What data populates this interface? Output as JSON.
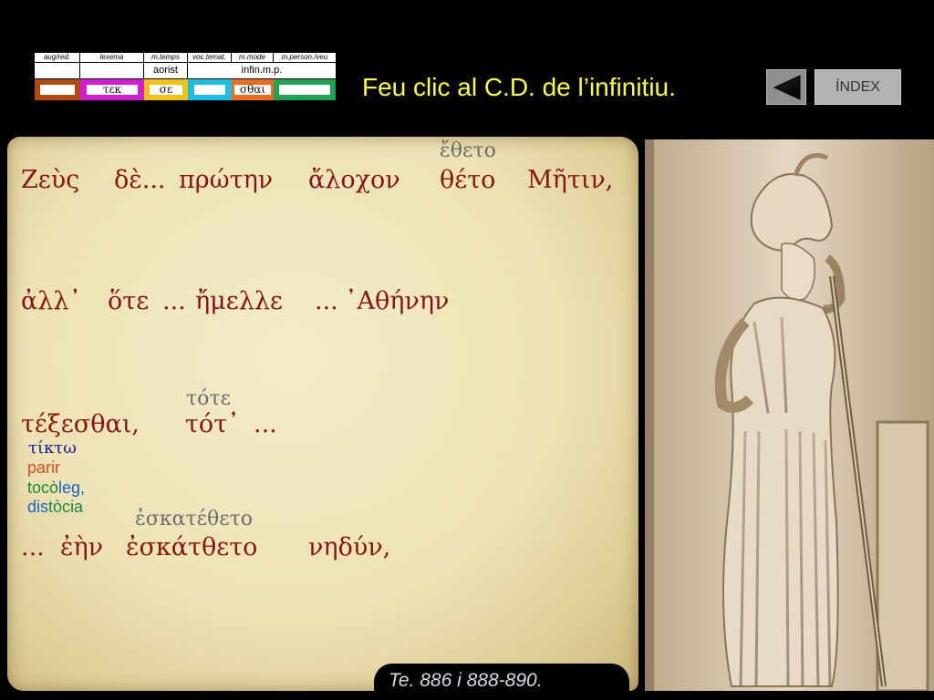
{
  "morph_table": {
    "headers": [
      "aug/red.",
      "lexema",
      "m.temps",
      "voc.temat.",
      "m.mode",
      "m.person./veu"
    ],
    "tense_value": "aorist",
    "mode_value": "infin.m.p.",
    "boxes": [
      {
        "text": "",
        "color": "#b04a10"
      },
      {
        "text": "τεκ",
        "color": "#d21bd2"
      },
      {
        "text": "σε",
        "color": "#f2c212"
      },
      {
        "text": "",
        "color": "#1bbde0"
      },
      {
        "text": "σθαι",
        "color": "#ef6a1a"
      },
      {
        "text": "",
        "color": "#1ea352"
      }
    ]
  },
  "instruction": "Feu clic al C.D. de l’infinitiu.",
  "nav": {
    "back_label": "",
    "index_label": "ÍNDEX"
  },
  "text_lines": {
    "line1_words": [
      "Ζεὺς",
      "δὲ...",
      "πρώτην",
      "ἄλοχον",
      "θέτο",
      "Μῆτιν,"
    ],
    "line1_annotation": "ἔθετο",
    "line2_words": [
      "ἀλλ᾽",
      "ὅτε",
      "...",
      "ἤμελλε",
      "...",
      "᾽Αθήνην"
    ],
    "line3_words": [
      "τέξεσθαι,",
      "τότ᾽",
      "..."
    ],
    "line3_annotation": "τότε",
    "gloss_greek": "τίκτω",
    "gloss_parir": "parir",
    "gloss_toco": "tocò",
    "gloss_leg": "leg,",
    "gloss_dis": "dis",
    "gloss_tocia": "tòcia",
    "line4_words": [
      "...",
      "ἐὴν",
      "ἐσκάτθετο",
      "νηδύν,"
    ],
    "line4_annotation": "ἐσκατέθετο"
  },
  "reference": "Te. 886 i 888-890.",
  "colors": {
    "greek_text": "#8a1313",
    "instruction": "#ffff33",
    "gloss_greek": "#1a1a8c",
    "gloss_parir": "#e8451b",
    "gloss_green": "#138a3d",
    "gloss_blue": "#1763c2"
  },
  "image": {
    "icon": "athena-relief"
  }
}
